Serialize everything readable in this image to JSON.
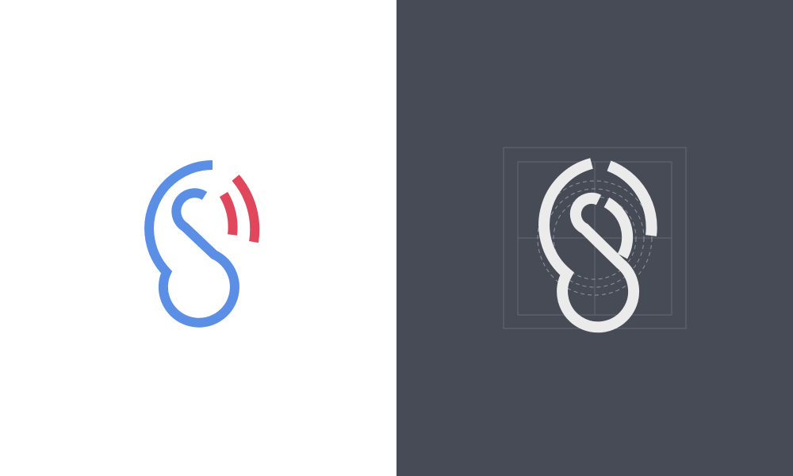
{
  "panels": {
    "left": {
      "background": "#ffffff",
      "logo": {
        "icon": "ear-sound-waves-logo",
        "primary_color": "#5b8fe6",
        "accent_color": "#e0475c"
      }
    },
    "right": {
      "background": "#474b56",
      "logo": {
        "icon": "ear-sound-waves-logo-construction",
        "primary_color": "#ebebeb",
        "grid_color": "#646a76",
        "guide_color": "#8e939d"
      }
    }
  }
}
